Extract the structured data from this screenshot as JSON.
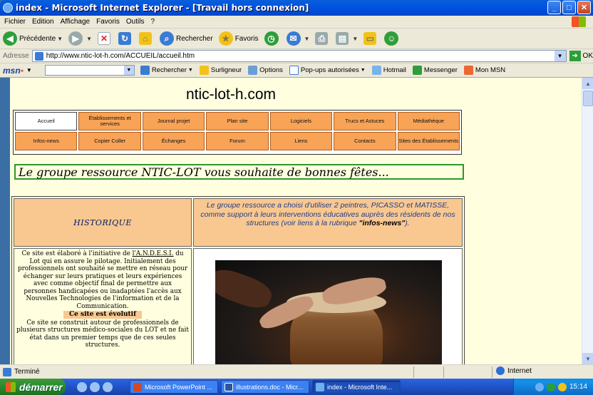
{
  "window": {
    "title": "index - Microsoft Internet Explorer - [Travail hors connexion]",
    "minimize": "_",
    "maximize": "□",
    "close": "✕"
  },
  "menu": [
    "Fichier",
    "Edition",
    "Affichage",
    "Favoris",
    "Outils",
    "?"
  ],
  "toolbar": {
    "back": "Précédente",
    "search": "Rechercher",
    "favorites": "Favoris"
  },
  "address": {
    "label": "Adresse",
    "url": "http://www.ntic-lot-h.com/ACCUEIL/accueil.htm",
    "go": "OK"
  },
  "msn": {
    "logo": "msn",
    "search": "Rechercher",
    "highlight": "Surligneur",
    "options": "Options",
    "popups": "Pop-ups autorisées",
    "hotmail": "Hotmail",
    "messenger": "Messenger",
    "mymsn": "Mon MSN"
  },
  "page": {
    "site_title": "ntic-lot-h.com",
    "nav_row1": [
      "Accueil",
      "Établissements et services",
      "Journal projet",
      "Plan site",
      "Logiciels",
      "Trucs et Astuces",
      "Médiathèque"
    ],
    "nav_row2": [
      "Infos-news",
      "Copier Coller",
      "Échanges",
      "Forum",
      "Liens",
      "Contacts",
      "Sites des Établissements"
    ],
    "banner": "Le groupe ressource NTIC-LOT vous souhaite de bonnes fêtes...",
    "historique": "HISTORIQUE",
    "intro_text": "Le groupe ressource a choisi d'utiliser 2 peintres,  PICASSO et MATISSE, comme support à leurs interventions éducatives auprès des résidents de nos structures (voir liens à la rubrique",
    "intro_link": "\"infos-news\"",
    "intro_end": ").",
    "left_p1_a": "Ce site est élaboré à l'initiative de ",
    "left_p1_link": "l'A.N.D.E.S.I.",
    "left_p1_b": " du Lot  qui en assure le pilotage. Initialement des professionnels ont souhaité se mettre en réseau pour échanger sur leurs pratiques et leurs expériences avec comme objectif final de permettre aux personnes handicapées ou inadaptées l'accès aux Nouvelles Technologies de l'information et de la Communication.",
    "evolutif": "Ce site est évolutif",
    "left_p2": "Ce site se construit autour de professionnels de plusieurs structures médico-sociales du LOT et ne fait état dans un premier temps que de ces seules structures."
  },
  "status": {
    "text": "Terminé",
    "zone": "Internet"
  },
  "taskbar": {
    "start": "démarrer",
    "tasks": [
      "Microsoft PowerPoint ...",
      "illustrations.doc - Micr...",
      "index - Microsoft Inte..."
    ],
    "clock": "15:14"
  }
}
